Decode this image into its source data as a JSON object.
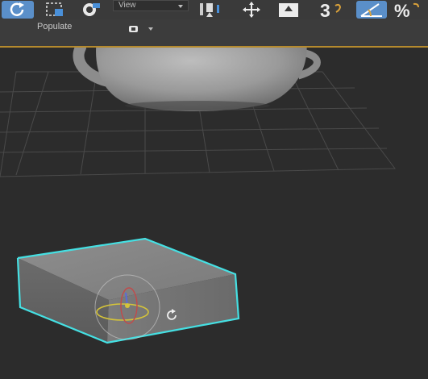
{
  "toolbar": {
    "view_dropdown": {
      "selected": "View"
    },
    "snap_label": "3",
    "percent_label": "%",
    "icons": [
      "undo-redo-icon",
      "select-region-icon",
      "link-icon",
      "view-dropdown",
      "pivot-icon",
      "move-icon",
      "manipulate-icon",
      "snap-3d-icon",
      "angle-snap-icon",
      "percent-snap-icon"
    ]
  },
  "ribbon": {
    "label": "Populate",
    "icon": "populate-flow-icon"
  },
  "viewport": {
    "objects": [
      "teapot",
      "box"
    ],
    "selected_object": "box",
    "selection_color": "#45e0e3",
    "grid": true
  }
}
